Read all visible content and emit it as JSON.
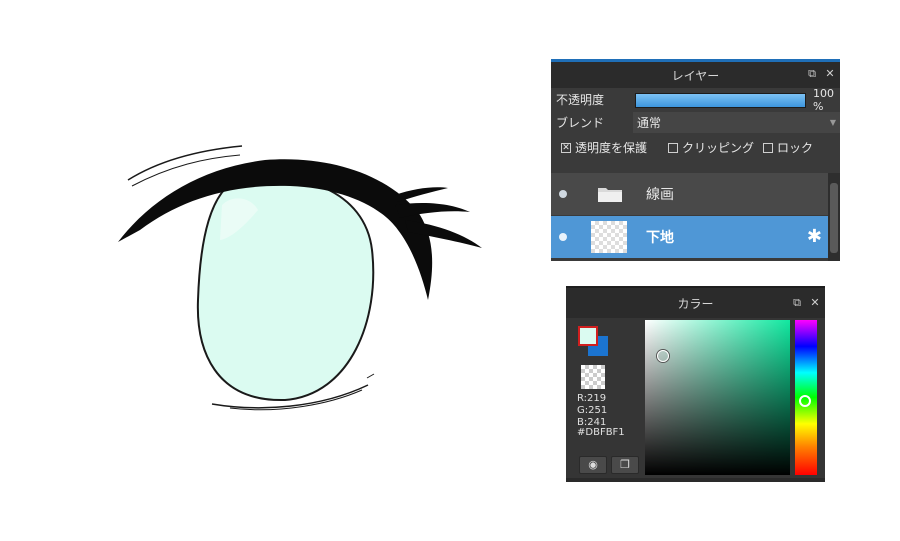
{
  "layer_panel": {
    "title": "レイヤー",
    "opacity_label": "不透明度",
    "opacity_value": "100 %",
    "opacity_fraction": 1.0,
    "blend_label": "ブレンド",
    "blend_value": "通常",
    "checks": [
      {
        "label": "透明度を保護",
        "checked": true
      },
      {
        "label": "クリッピング",
        "checked": false
      },
      {
        "label": "ロック",
        "checked": false
      }
    ],
    "layers": [
      {
        "name": "線画",
        "type": "folder"
      },
      {
        "name": "下地",
        "type": "layer",
        "selected": true
      }
    ],
    "icons": {
      "popout": "popout-icon",
      "close": "close-icon",
      "gear": "gear-icon",
      "folder": "folder-icon"
    }
  },
  "color_panel": {
    "title": "カラー",
    "r": "R:219",
    "g": "G:251",
    "b": "B:241",
    "hex": "#DBFBF1",
    "foreground_color": "#DBFBF1",
    "background_color": "#1B74D0"
  }
}
